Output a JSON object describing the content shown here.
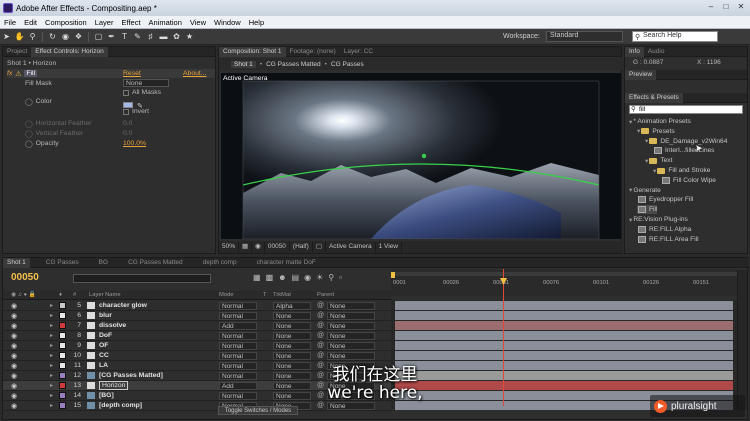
{
  "window": {
    "title": "Adobe After Effects - Compositing.aep *"
  },
  "menu": [
    "File",
    "Edit",
    "Composition",
    "Layer",
    "Effect",
    "Animation",
    "View",
    "Window",
    "Help"
  ],
  "workspace": {
    "label": "Workspace:",
    "value": "Standard"
  },
  "search_help": {
    "placeholder": "Search Help"
  },
  "left_panel": {
    "tabs": [
      "Project",
      "Effect Controls: Horizon"
    ],
    "breadcrumb": "Shot 1 • Horizon",
    "effect_name": "Fill",
    "reset": "Reset",
    "about": "About...",
    "fill_mask_label": "Fill Mask",
    "fill_mask_value": "None",
    "all_masks": "All Masks",
    "color_label": "Color",
    "invert": "Invert",
    "horizontal_feather": "Horizontal Feather",
    "horizontal_feather_value": "0.0",
    "vertical_feather": "Vertical Feather",
    "vertical_feather_value": "0.0",
    "opacity_label": "Opacity",
    "opacity_value": "100.0%",
    "color_hex": "#a9b6e8"
  },
  "comp_panel": {
    "tabs": [
      "Composition: Shot 1",
      "Footage: (none)",
      "Layer: CC"
    ],
    "breadcrumbs": [
      "Shot 1",
      "CG Passes Matted",
      "CG Passes"
    ],
    "view_label": "Active Camera",
    "bottom": {
      "zoom": "50%",
      "timecode": "00050",
      "resolution": "(Half)",
      "camera": "Active Camera",
      "views": "1 View"
    }
  },
  "right_panel": {
    "info_tab": "Info",
    "audio_tab": "Audio",
    "info_values": [
      "G : 0.0887",
      "X : 1196"
    ],
    "preview_tab": "Preview",
    "fx_tab": "Effects & Presets",
    "search_value": "fill",
    "tree": [
      {
        "label": "* Animation Presets",
        "indent": 0,
        "icon": "none"
      },
      {
        "label": "Presets",
        "indent": 1,
        "icon": "folder"
      },
      {
        "label": "DE_Damage_v2Win64",
        "indent": 2,
        "icon": "folder"
      },
      {
        "label": "Interl...filledLines",
        "indent": 3,
        "icon": "fx"
      },
      {
        "label": "Text",
        "indent": 2,
        "icon": "folder"
      },
      {
        "label": "Fill and Stroke",
        "indent": 3,
        "icon": "folder"
      },
      {
        "label": "Fill Color Wipe",
        "indent": 4,
        "icon": "fx"
      },
      {
        "label": "Generate",
        "indent": 0,
        "icon": "none"
      },
      {
        "label": "Eyedropper Fill",
        "indent": 1,
        "icon": "fx"
      },
      {
        "label": "Fill",
        "indent": 1,
        "icon": "fx"
      },
      {
        "label": "RE:Vision Plug-ins",
        "indent": 0,
        "icon": "none"
      },
      {
        "label": "RE:FILL Alpha",
        "indent": 1,
        "icon": "fx"
      },
      {
        "label": "RE:FILL Area Fill",
        "indent": 1,
        "icon": "fx"
      }
    ]
  },
  "timeline": {
    "tabs": [
      "Shot 1",
      "CG Passes",
      "BG",
      "CG Passes Matted",
      "depth comp",
      "character matte DoF"
    ],
    "timecode": "00050",
    "columns": {
      "layer_name": "Layer Name",
      "mode": "Mode",
      "t": "T",
      "trkmat": "TrkMat",
      "parent": "Parent"
    },
    "ruler_labels": [
      "0001",
      "00026",
      "00051",
      "00076",
      "00101",
      "00126",
      "00151"
    ],
    "layers": [
      {
        "num": "5",
        "name": "character glow",
        "mode": "Normal",
        "trk": "Alpha",
        "parent": "None",
        "label_color": "#c8c8c8",
        "bar": "#8a8f9a",
        "selected": false
      },
      {
        "num": "6",
        "name": "blur",
        "mode": "Normal",
        "trk": "None",
        "parent": "None",
        "label_color": "#e8e8e8",
        "bar": "#8a8f9a",
        "selected": false
      },
      {
        "num": "7",
        "name": "dissolve",
        "mode": "Add",
        "trk": "None",
        "parent": "None",
        "label_color": "#d03a3a",
        "bar": "#9b6d70",
        "selected": false
      },
      {
        "num": "8",
        "name": "DoF",
        "mode": "Normal",
        "trk": "None",
        "parent": "None",
        "label_color": "#e8e8e8",
        "bar": "#8a8f9a",
        "selected": false
      },
      {
        "num": "9",
        "name": "OF",
        "mode": "Normal",
        "trk": "None",
        "parent": "None",
        "label_color": "#e8e8e8",
        "bar": "#8a8f9a",
        "selected": false
      },
      {
        "num": "10",
        "name": "CC",
        "mode": "Normal",
        "trk": "None",
        "parent": "None",
        "label_color": "#e8e8e8",
        "bar": "#8a8f9a",
        "selected": false
      },
      {
        "num": "11",
        "name": "LA",
        "mode": "Normal",
        "trk": "None",
        "parent": "None",
        "label_color": "#e8e8e8",
        "bar": "#8a8f9a",
        "selected": false
      },
      {
        "num": "12",
        "name": "[CG Passes Matted]",
        "mode": "Normal",
        "trk": "None",
        "parent": "None",
        "label_color": "#9a7fc0",
        "bar": "#9a9a9a",
        "selected": false
      },
      {
        "num": "13",
        "name": "Horizon",
        "mode": "Add",
        "trk": "None",
        "parent": "None",
        "label_color": "#d03a3a",
        "bar": "#b04a4a",
        "selected": true
      },
      {
        "num": "14",
        "name": "[BG]",
        "mode": "Normal",
        "trk": "None",
        "parent": "None",
        "label_color": "#9a7fc0",
        "bar": "#8a8f9a",
        "selected": false
      },
      {
        "num": "15",
        "name": "[depth comp]",
        "mode": "Normal",
        "trk": "None",
        "parent": "None",
        "label_color": "#9a7fc0",
        "bar": "#8a8f9a",
        "selected": false
      }
    ],
    "toggle_label": "Toggle Switches / Modes"
  },
  "subtitle": {
    "cn": "我们在这里",
    "en": "we're here,"
  },
  "watermark": "pluralsight"
}
